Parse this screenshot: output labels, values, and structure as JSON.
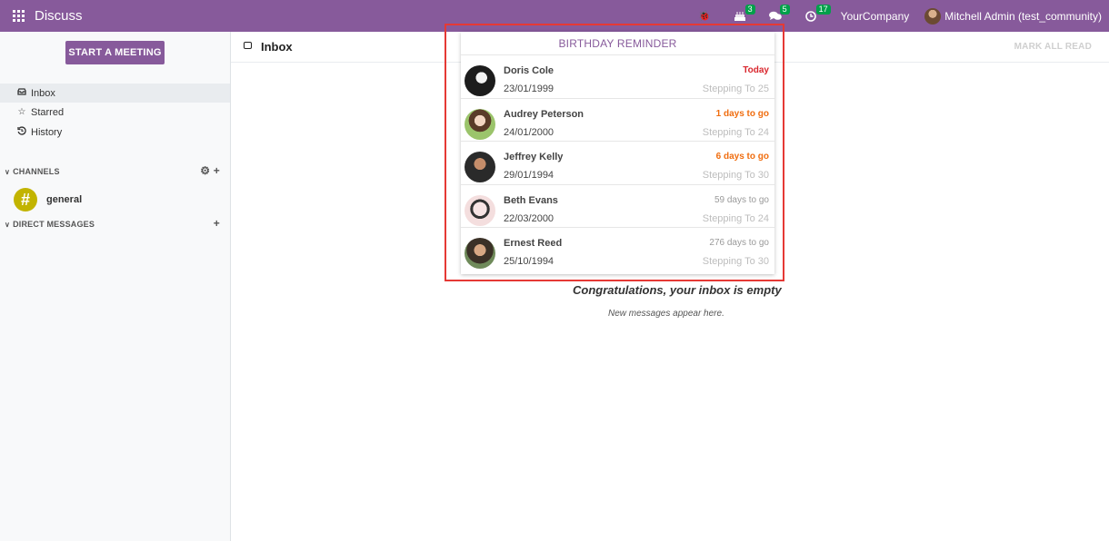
{
  "navbar": {
    "app_title": "Discuss",
    "activity_badge": "3",
    "messages_badge": "5",
    "clock_badge": "17",
    "company": "YourCompany",
    "user": "Mitchell Admin (test_community)"
  },
  "sidebar": {
    "start_meeting": "START A MEETING",
    "items": [
      {
        "label": "Inbox",
        "icon": "inbox-icon"
      },
      {
        "label": "Starred",
        "icon": "star-icon"
      },
      {
        "label": "History",
        "icon": "history-icon"
      }
    ],
    "channels_label": "CHANNELS",
    "channel": {
      "symbol": "#",
      "name": "general"
    },
    "direct_label": "DIRECT MESSAGES"
  },
  "main": {
    "title": "Inbox",
    "mark_all_read": "MARK ALL READ",
    "empty_title": "Congratulations, your inbox is empty",
    "empty_sub": "New messages appear here."
  },
  "birthday": {
    "title": "BIRTHDAY REMINDER",
    "rows": [
      {
        "name": "Doris Cole",
        "date": "23/01/1999",
        "days": "Today",
        "step": "Stepping To 25"
      },
      {
        "name": "Audrey Peterson",
        "date": "24/01/2000",
        "days": "1 days to go",
        "step": "Stepping To 24"
      },
      {
        "name": "Jeffrey Kelly",
        "date": "29/01/1994",
        "days": "6 days to go",
        "step": "Stepping To 30"
      },
      {
        "name": "Beth Evans",
        "date": "22/03/2000",
        "days": "59 days to go",
        "step": "Stepping To 24"
      },
      {
        "name": "Ernest Reed",
        "date": "25/10/1994",
        "days": "276 days to go",
        "step": "Stepping To 30"
      }
    ]
  },
  "colors": {
    "brand": "#875a9b",
    "highlight": "#e53935",
    "today": "#d9262d",
    "soon": "#f06d0f",
    "badge": "#00a04a"
  }
}
